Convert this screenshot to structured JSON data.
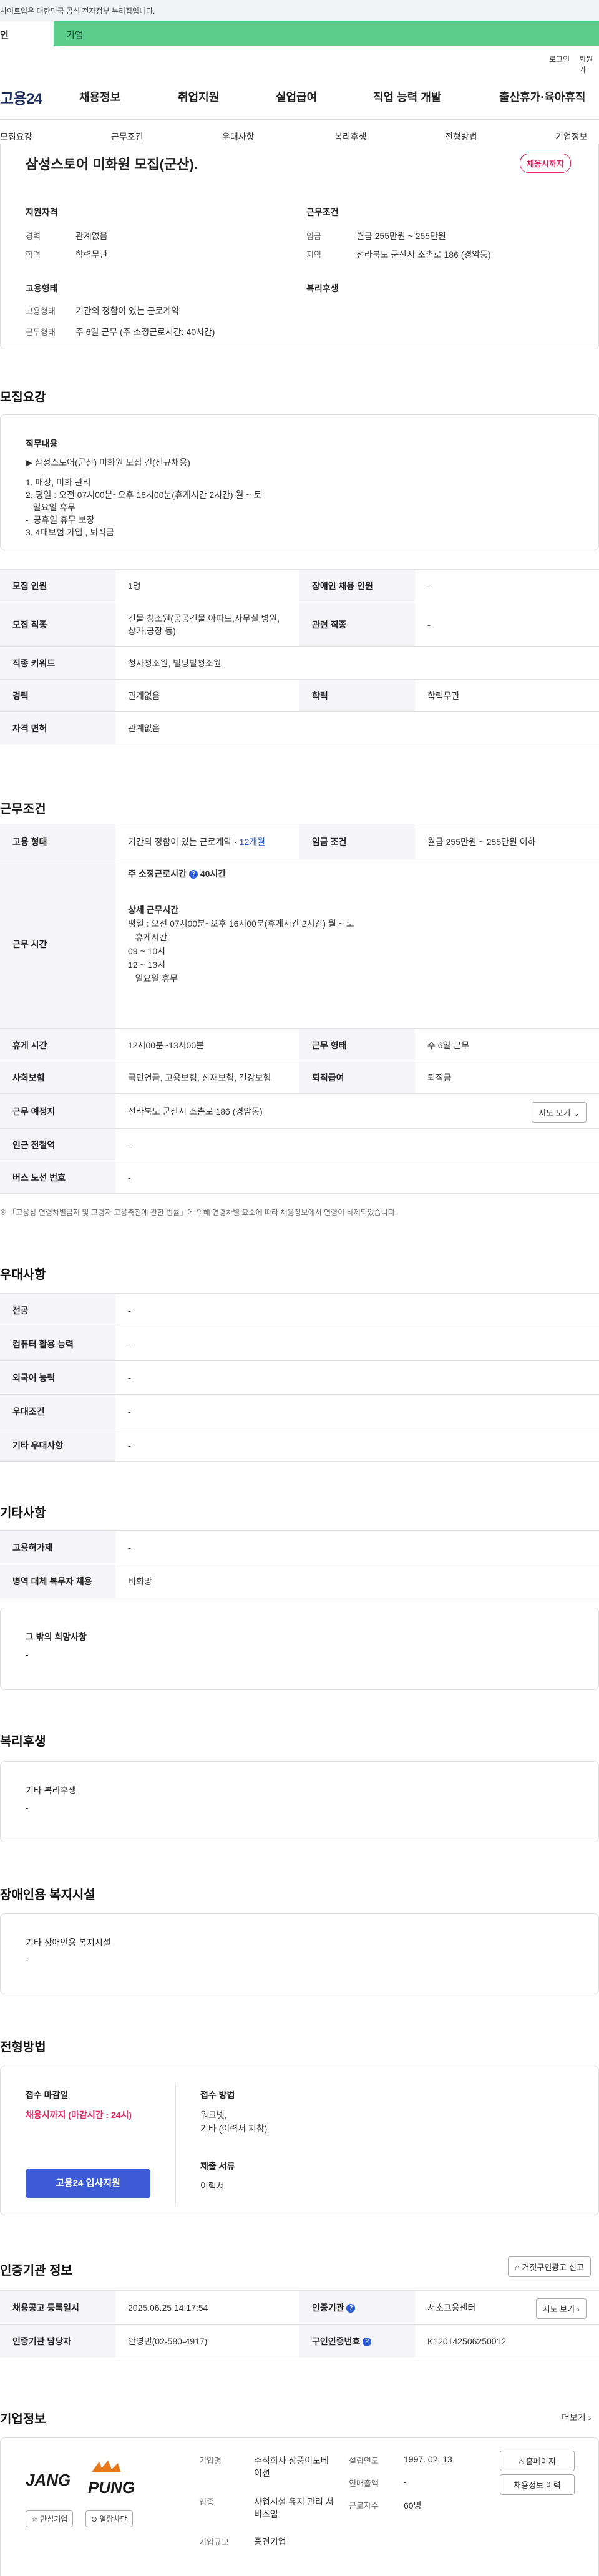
{
  "govbar": {
    "text": "사이트입은 대한민국 공식 전자정부 누리집입니다."
  },
  "tabs": {
    "person": "인",
    "company": "기업"
  },
  "util": {
    "login": "로그인",
    "join": "회원가"
  },
  "gnb": {
    "logo": "고용24",
    "items": [
      "채용정보",
      "취업지원",
      "실업급여",
      "직업 능력 개발",
      "출산휴가·육아휴직"
    ]
  },
  "lnb": {
    "items": [
      "모집요강",
      "근무조건",
      "우대사항",
      "복리후생",
      "전형방법",
      "기업정보"
    ]
  },
  "summary": {
    "title": "삼성스토어 미화원 모집(군산).",
    "badge": "채용시까지",
    "qual_title": "지원자격",
    "career_label": "경력",
    "career": "관계없음",
    "edu_label": "학력",
    "edu": "학력무관",
    "cond_title": "근무조건",
    "wage_label": "임금",
    "wage": "월급 255만원 ~ 255만원",
    "region_label": "지역",
    "region": "전라북도 군산시 조촌로 186 (경암동)",
    "emp_title": "고용형태",
    "emp_label": "고용형태",
    "emp": "기간의 정함이 있는 근로계약",
    "work_label": "근무형태",
    "work": "주 6일 근무 (주 소정근로시간: 40시간)",
    "welfare_title": "복리후생"
  },
  "recruit": {
    "title": "모집요강",
    "duty_title": "직무내용",
    "duty_lines": [
      "▶ 삼성스토어(군산) 미화원 모집 건(신규채용)",
      "",
      "1. 매장, 미화 관리",
      "2. 평일 : 오전 07시00분~오후 16시00분(휴게시간 2시간) 월 ~ 토",
      "   일요일 휴무",
      "-  공휴일 휴무 보장",
      "3. 4대보험 가입 , 퇴직금"
    ],
    "rows": [
      {
        "l1": "모집 인원",
        "v1": "1명",
        "l2": "장애인 채용 인원",
        "v2": "-"
      },
      {
        "l1": "모집 직종",
        "v1": "건물 청소원(공공건물,아파트,사무실,병원,상가,공장 등)",
        "l2": "관련 직종",
        "v2": "-"
      },
      {
        "l1": "직종 키워드",
        "v1": "청사청소원, 빌딩빌청소원"
      },
      {
        "l1": "경력",
        "v1": "관계없음",
        "l2": "학력",
        "v2": "학력무관"
      },
      {
        "l1": "자격 면허",
        "v1": "관계없음"
      }
    ]
  },
  "work": {
    "title": "근무조건",
    "emp_label": "고용 형태",
    "emp": "기간의 정함이 있는 근로계약 · ",
    "emp_months": "12개월",
    "wage_label": "임금 조건",
    "wage": "월급 255만원 ~ 255만원 이하",
    "hours_label": "근무 시간",
    "hours_week": "주 소정근로시간",
    "hours_week_val": "40시간",
    "hours_detail_title": "상세 근무시간",
    "hours_lines": [
      "평일 : 오전 07시00분~오후 16시00분(휴게시간 2시간) 월 ~ 토",
      "   휴게시간",
      "09 ~ 10시",
      "12 ~ 13시",
      "   일요일 휴무"
    ],
    "break_label": "휴게 시간",
    "break": "12시00분~13시00분",
    "form_label": "근무 형태",
    "form": "주 6일 근무",
    "ins_label": "사회보험",
    "ins": "국민연금, 고용보험, 산재보험, 건강보험",
    "sev_label": "퇴직급여",
    "sev": "퇴직금",
    "place_label": "근무 예정지",
    "place": "전라북도 군산시 조촌로 186 (경암동)",
    "map_btn": "지도 보기",
    "station_label": "인근 전철역",
    "station": "-",
    "bus_label": "버스 노선 번호",
    "bus": "-",
    "note": "※ 「고용상 연령차별금지 및 고령자 고용촉진에 관한 법률」에 의해 연령차별 요소에 따라 채용정보에서 연령이 삭제되었습니다."
  },
  "pref": {
    "title": "우대사항",
    "rows": [
      {
        "l": "전공",
        "v": "-"
      },
      {
        "l": "컴퓨터 활용 능력",
        "v": "-"
      },
      {
        "l": "외국어 능력",
        "v": "-"
      },
      {
        "l": "우대조건",
        "v": "-"
      },
      {
        "l": "기타 우대사항",
        "v": "-"
      }
    ]
  },
  "etc": {
    "title": "기타사항",
    "rows": [
      {
        "l": "고용허가제",
        "v": "-"
      },
      {
        "l": "병역 대체 복무자 채용",
        "v": "비희망"
      }
    ],
    "other_title": "그 밖의 희망사항",
    "other": "-"
  },
  "welfare": {
    "title": "복리후생",
    "box_title": "기타 복리후생",
    "box_val": "-"
  },
  "disab": {
    "title": "장애인용 복지시설",
    "box_title": "기타 장애인용 복지시설",
    "box_val": "-"
  },
  "apply": {
    "title": "전형방법",
    "deadline_label": "접수 마감일",
    "deadline": "채용시까지 (마감시간 : 24시)",
    "apply_btn": "고용24 입사지원",
    "method_label": "접수 방법",
    "method1": "워크넷,",
    "method2": "기타 (이력서 지참)",
    "docs_label": "제출 서류",
    "docs": "이력서"
  },
  "cert": {
    "title": "인증기관 정보",
    "report_btn": "거짓구인광고 신고",
    "reg_label": "채용공고 등록일시",
    "reg": "2025.06.25 14:17:54",
    "org_label": "인증기관",
    "org": "서초고용센터",
    "map_btn": "지도 보기",
    "mgr_label": "인증기관 담당자",
    "mgr": "안영민(02-580-4917)",
    "no_label": "구인인증번호",
    "no": "K120142506250012"
  },
  "company": {
    "title": "기업정보",
    "more": "더보기",
    "logo_a": "JANG",
    "logo_b": "PUNG",
    "fav_btn": "관심기업",
    "block_btn": "열람차단",
    "name_label": "기업명",
    "name": "주식회사 장풍이노베이션",
    "biz_label": "업종",
    "biz": "사업시설 유지 관리 서비스업",
    "size_label": "기업규모",
    "size": "중견기업",
    "year_label": "설립연도",
    "year": "1997. 02. 13",
    "sales_label": "연매출액",
    "sales": "-",
    "emp_label": "근로자수",
    "emp": "60명",
    "home_btn": "홈페이지",
    "jobs_btn": "채용정보 이력"
  },
  "colors": {
    "brand_green": "#5ccd8b",
    "accent_red": "#e0245e",
    "primary_blue": "#3d5bd6"
  }
}
